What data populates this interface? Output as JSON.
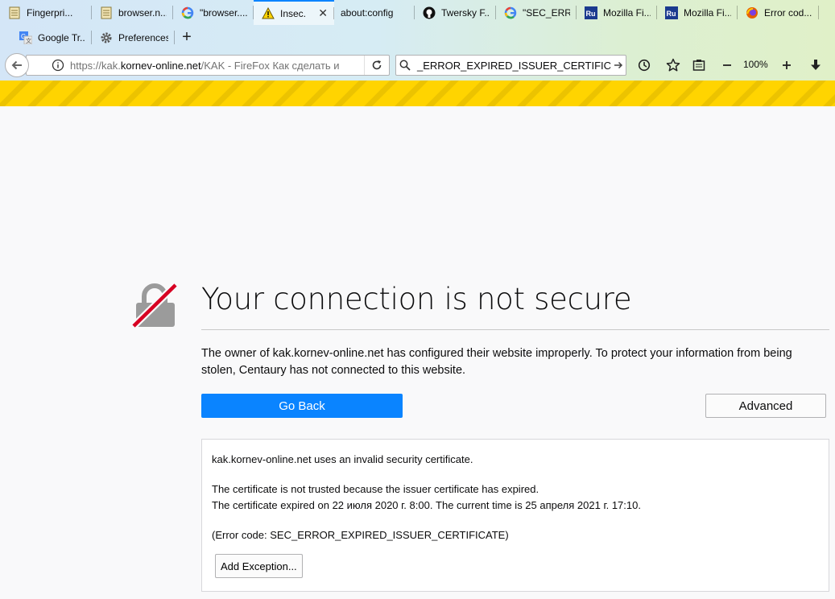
{
  "tabs_row1": [
    {
      "label": "Fingerpri...",
      "icon": "document-icon"
    },
    {
      "label": "browser.n...",
      "icon": "document-icon"
    },
    {
      "label": "\"browser....",
      "icon": "google-icon"
    },
    {
      "label": "Insec...",
      "icon": "warning-icon",
      "active": true
    },
    {
      "label": "about:config",
      "icon": "none"
    },
    {
      "label": "Twersky F...",
      "icon": "github-icon"
    },
    {
      "label": "\"SEC_ERR...",
      "icon": "google-icon"
    },
    {
      "label": "Mozilla Fi...",
      "icon": "ru-icon"
    },
    {
      "label": "Mozilla Fi...",
      "icon": "ru-icon"
    },
    {
      "label": "Error cod...",
      "icon": "firefox-icon"
    }
  ],
  "tabs_row2": [
    {
      "label": "Google Tr...",
      "icon": "google-translate-icon"
    },
    {
      "label": "Preferences",
      "icon": "gear-icon"
    }
  ],
  "newtab_label": "+",
  "urlbar": {
    "prefix": "https://kak.",
    "host": "kornev-online.net",
    "suffix": "/KAK - FireFox Как сделать и"
  },
  "searchbar": {
    "value": "_ERROR_EXPIRED_ISSUER_CERTIFICATE\""
  },
  "zoom": "100%",
  "error_page": {
    "title": "Your connection is not secure",
    "description": "The owner of kak.kornev-online.net has configured their website improperly. To protect your information from being stolen, Centaury has not connected to this website.",
    "go_back": "Go Back",
    "advanced": "Advanced",
    "advanced_panel": {
      "line1": "kak.kornev-online.net uses an invalid security certificate.",
      "line2": "The certificate is not trusted because the issuer certificate has expired.",
      "line3": "The certificate expired on 22 июля 2020 г. 8:00. The current time is 25 апреля 2021 г. 17:10.",
      "line4": "(Error code: SEC_ERROR_EXPIRED_ISSUER_CERTIFICATE)",
      "add_exception": "Add Exception..."
    }
  },
  "colors": {
    "accent": "#0a84ff",
    "stripe_yellow": "#ffd400",
    "lock_gray": "#999999",
    "slash_red": "#d70022"
  }
}
